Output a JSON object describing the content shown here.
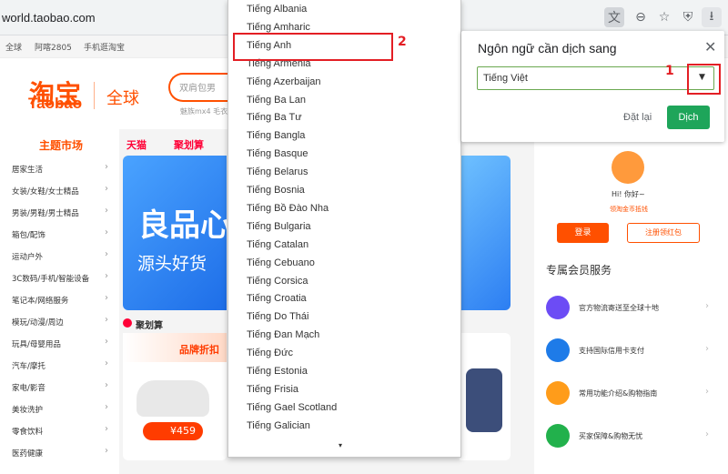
{
  "browser": {
    "url": "world.taobao.com",
    "icons": [
      "translate-icon",
      "zoom-out-icon",
      "star-icon",
      "shield-icon",
      "download-icon"
    ]
  },
  "topstrip": {
    "global": "全球",
    "location": "阿喀2805",
    "mobile": "手机逛淘宝"
  },
  "header": {
    "logo_cn": "淘宝",
    "logo_en": "Taobao",
    "logo_global": "全球",
    "search_placeholder": "双肩包男",
    "search_hints": "魅族mx4    毛衣"
  },
  "nav": {
    "theme_market": "主题市场",
    "tmall": "天猫",
    "juhuasuan": "聚划算"
  },
  "categories": [
    "居家生活",
    "女装/女鞋/女士精品",
    "男装/男鞋/男士精品",
    "箱包/配饰",
    "运动户外",
    "3C数码/手机/智能设备",
    "笔记本/网络服务",
    "模玩/动漫/周边",
    "玩具/母婴用品",
    "汽车/摩托",
    "家电/影音",
    "美妆洗护",
    "零食饮料",
    "医药健康"
  ],
  "banner": {
    "big": "良品心",
    "small": "源头好货"
  },
  "promo": {
    "title": "聚划算",
    "text": "品牌折扣",
    "price": "¥459"
  },
  "user": {
    "hello": "Hi! 你好~",
    "member_hint": "领淘金币抵钱",
    "login": "登录",
    "register": "注册领红包",
    "services_title": "专属会员服务",
    "services": [
      "官方物流寄送至全球十地",
      "支持国际信用卡支付",
      "常用功能介绍&购物指南",
      "买家保障&购物无忧"
    ]
  },
  "lang_dropdown": {
    "options": [
      "Tiếng Albania",
      "Tiếng Amharic",
      "Tiếng Anh",
      "Tiếng Armenia",
      "Tiếng Azerbaijan",
      "Tiếng Ba Lan",
      "Tiếng Ba Tư",
      "Tiếng Bangla",
      "Tiếng Basque",
      "Tiếng Belarus",
      "Tiếng Bosnia",
      "Tiếng Bồ Đào Nha",
      "Tiếng Bulgaria",
      "Tiếng Catalan",
      "Tiếng Cebuano",
      "Tiếng Corsica",
      "Tiếng Croatia",
      "Tiếng Do Thái",
      "Tiếng Đan Mạch",
      "Tiếng Đức",
      "Tiếng Estonia",
      "Tiếng Frisia",
      "Tiếng Gael Scotland",
      "Tiếng Galician"
    ],
    "scroll_down": "▾",
    "highlight_label": "2"
  },
  "translate_popup": {
    "title": "Ngôn ngữ cần dịch sang",
    "close": "✕",
    "selected_language": "Tiếng Việt",
    "highlight_label": "1",
    "reset": "Đặt lại",
    "translate": "Dịch"
  },
  "colors": {
    "brand": "#ff5000",
    "annotation": "#e31e24",
    "translate_btn": "#1ea55a"
  }
}
